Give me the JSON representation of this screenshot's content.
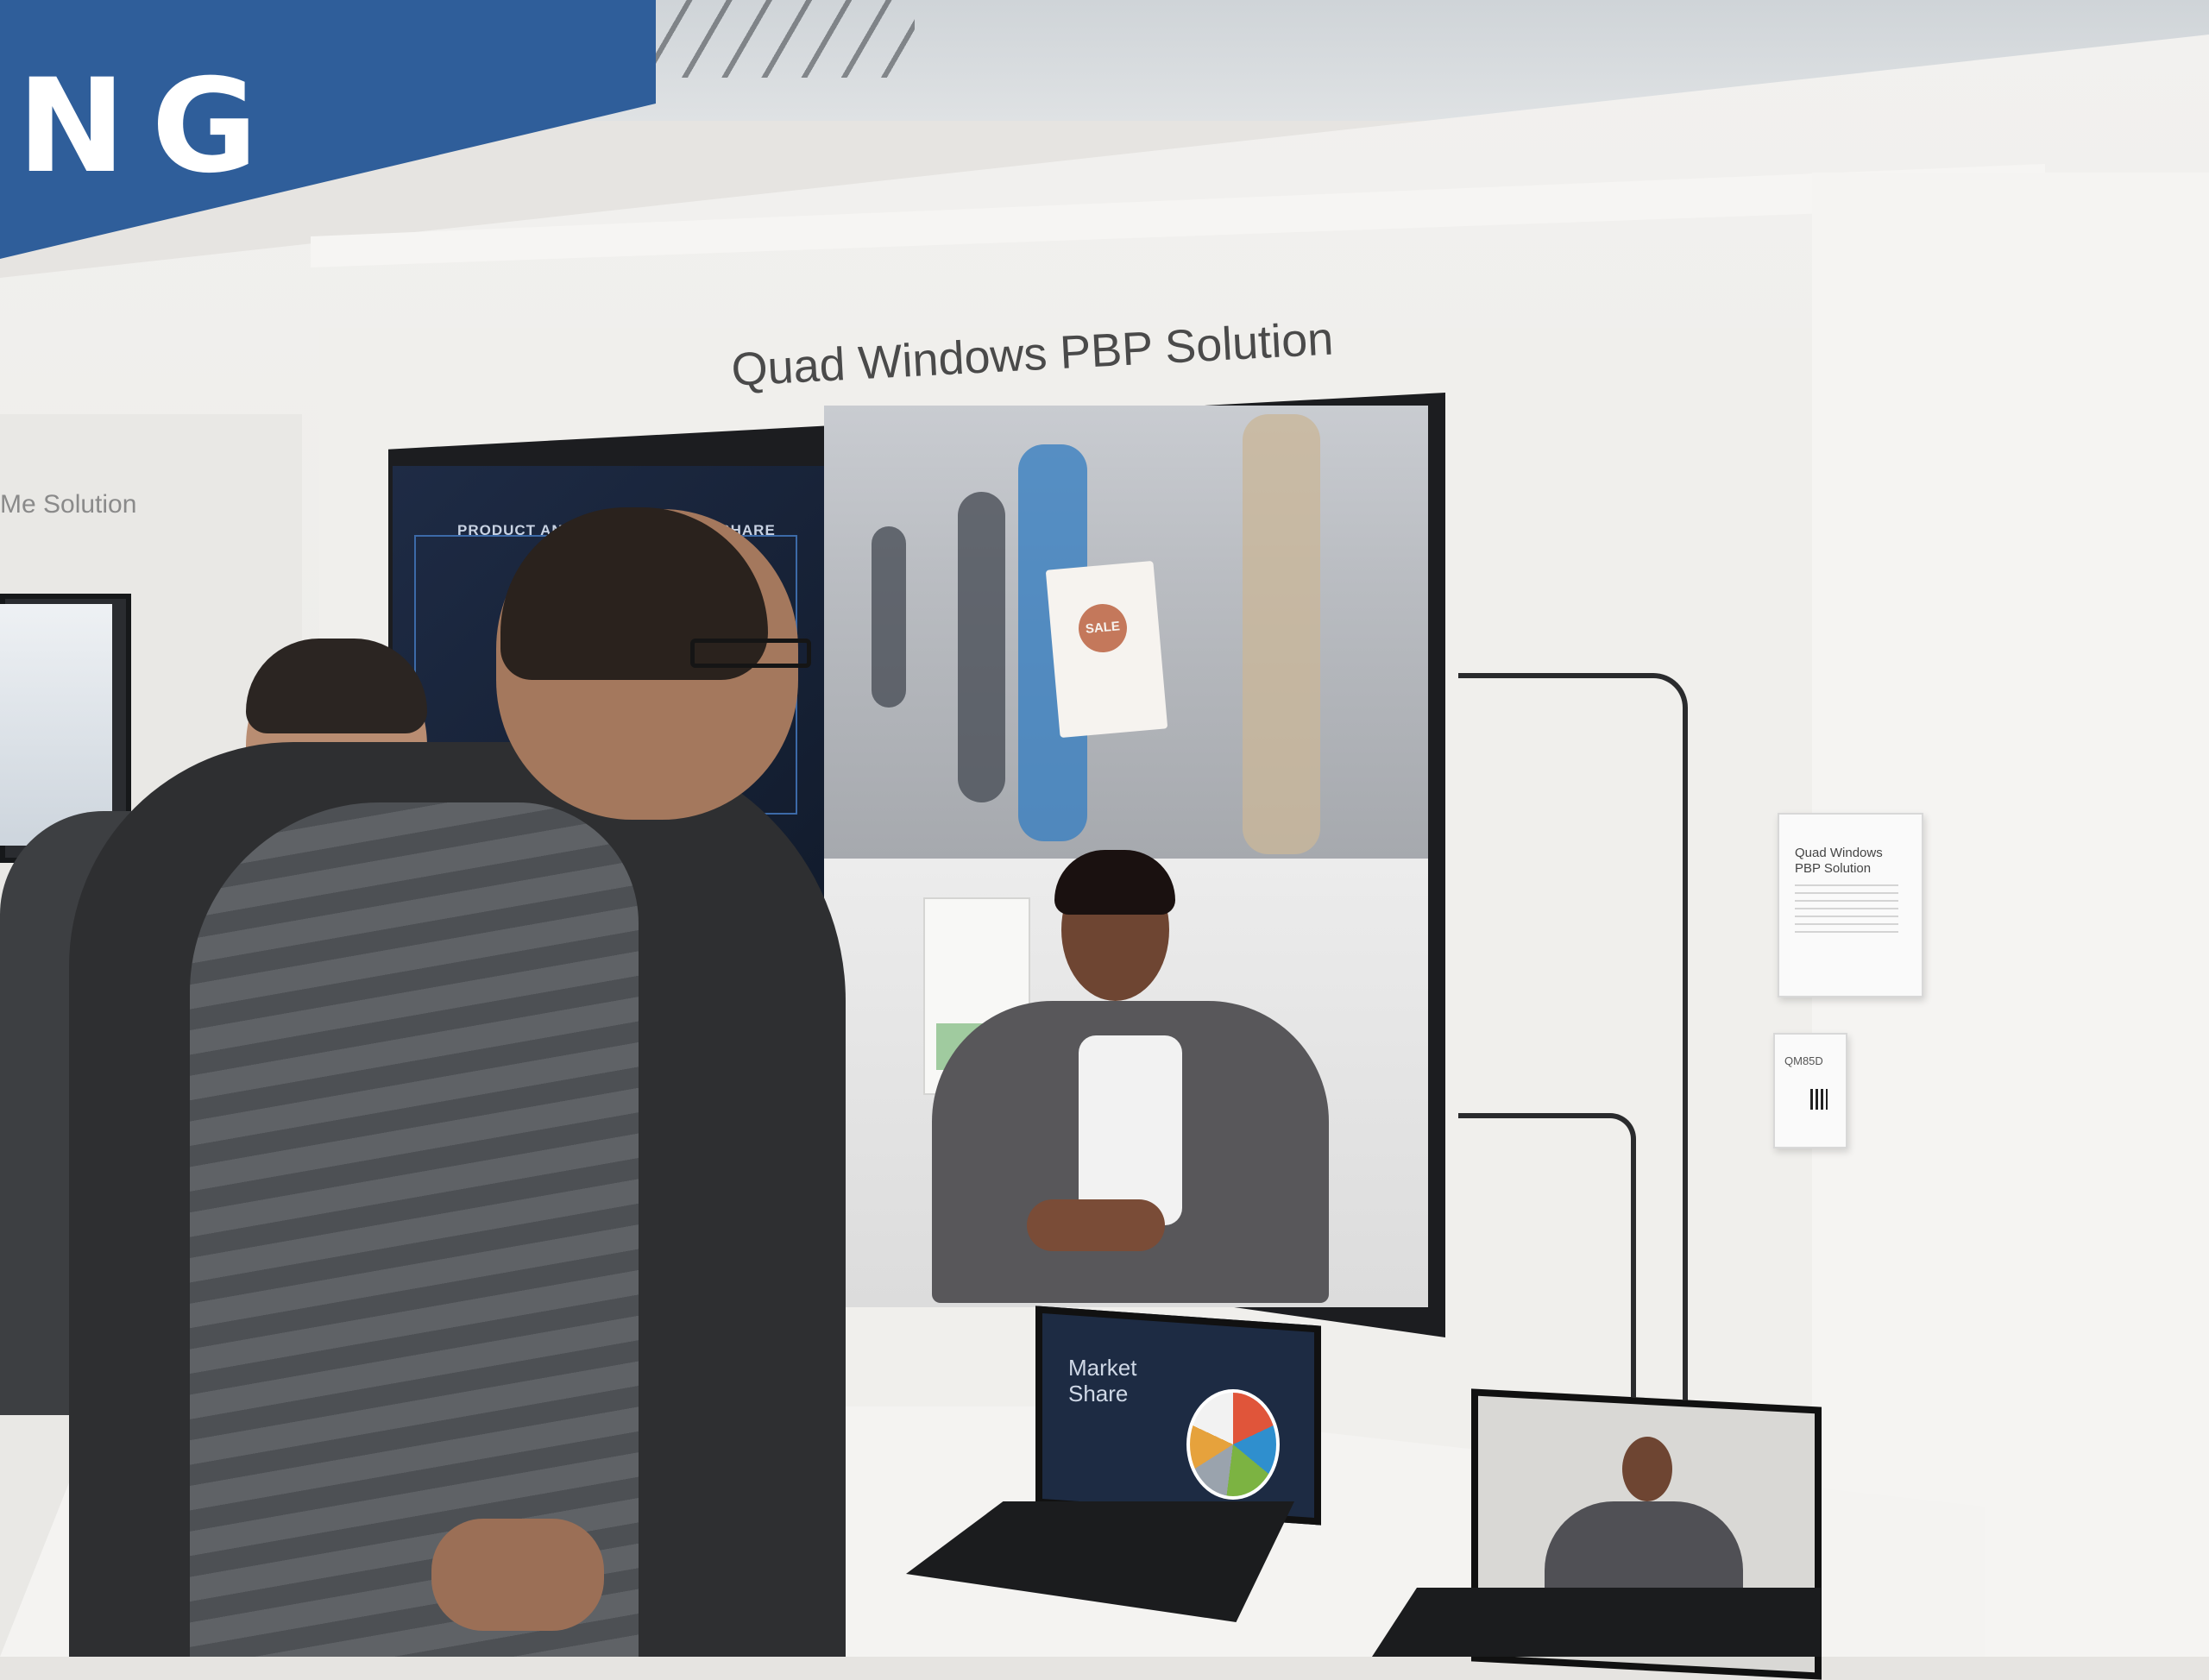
{
  "scene": {
    "brand_banner_text": "NG",
    "display_title": "Quad Windows PBP Solution",
    "left_panel_title": "Me Solution",
    "display": {
      "top_left_label": "PRODUCT ANALYSIS",
      "top_left_label_suffix": "SHARE",
      "bag_logo": "SALE"
    },
    "laptop_left": {
      "slide_title_line1": "Market",
      "slide_title_line2": "Share"
    },
    "info_card": {
      "title_line1": "Quad Windows",
      "title_line2": "PBP Solution"
    },
    "model_card": {
      "model": "QM85D"
    }
  },
  "colors": {
    "banner_blue": "#2f5e9a",
    "wall": "#f0efec",
    "display_frame": "#1c1d20"
  }
}
